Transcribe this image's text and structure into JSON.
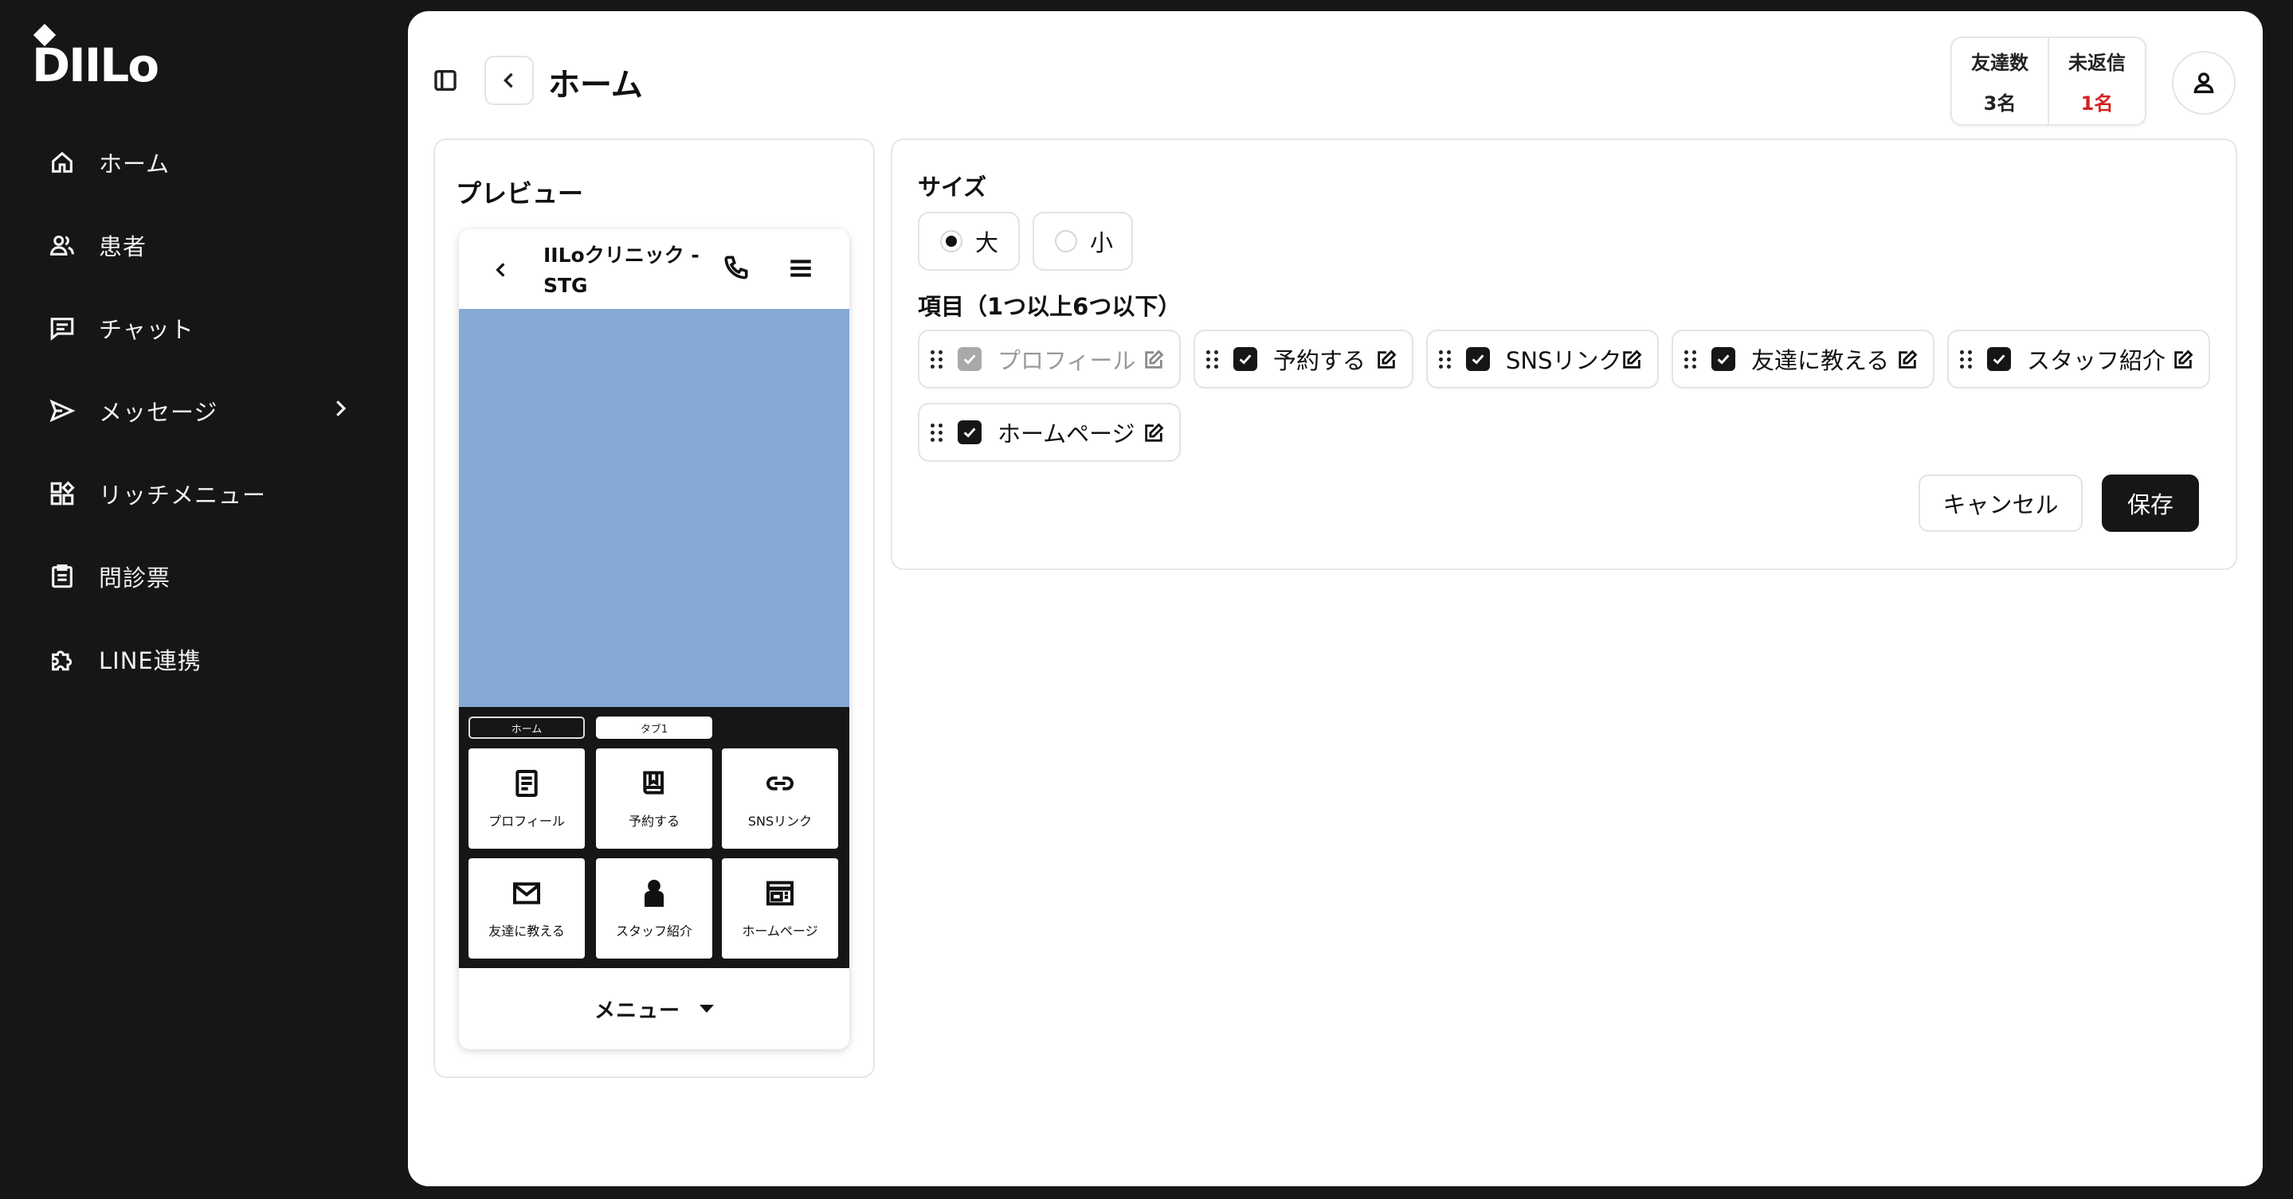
{
  "app": {
    "logo_text": "DIILo",
    "colors": {
      "sidebar_bg": "#161616",
      "hero_bg": "#86a9d6",
      "alert": "#d62020"
    }
  },
  "sidebar": {
    "items": [
      {
        "label": "ホーム",
        "icon": "home-icon"
      },
      {
        "label": "患者",
        "icon": "users-icon"
      },
      {
        "label": "チャット",
        "icon": "chat-icon"
      },
      {
        "label": "メッセージ",
        "icon": "send-icon",
        "has_submenu": true
      },
      {
        "label": "リッチメニュー",
        "icon": "grid-icon"
      },
      {
        "label": "問診票",
        "icon": "clipboard-icon"
      },
      {
        "label": "LINE連携",
        "icon": "puzzle-icon"
      }
    ]
  },
  "header": {
    "title": "ホーム",
    "stats": [
      {
        "label": "友達数",
        "value": "3名"
      },
      {
        "label": "未返信",
        "value": "1名"
      }
    ]
  },
  "preview": {
    "title": "プレビュー",
    "phone_title": "IILoクリニック - STG",
    "tabs": [
      "ホーム",
      "タブ1"
    ],
    "buttons": [
      {
        "label": "プロフィール",
        "icon": "document-icon"
      },
      {
        "label": "予約する",
        "icon": "book-icon"
      },
      {
        "label": "SNSリンク",
        "icon": "link-icon"
      },
      {
        "label": "友達に教える",
        "icon": "mail-icon"
      },
      {
        "label": "スタッフ紹介",
        "icon": "person-icon"
      },
      {
        "label": "ホームページ",
        "icon": "browser-icon"
      }
    ],
    "footer_label": "メニュー"
  },
  "settings": {
    "size_label": "サイズ",
    "size_options": [
      {
        "label": "大",
        "selected": true
      },
      {
        "label": "小",
        "selected": false
      }
    ],
    "items_label": "項目（1つ以上6つ以下）",
    "items": [
      {
        "label": "プロフィール",
        "checked": true,
        "disabled": true
      },
      {
        "label": "予約する",
        "checked": true,
        "disabled": false
      },
      {
        "label": "SNSリンク",
        "checked": true,
        "disabled": false
      },
      {
        "label": "友達に教える",
        "checked": true,
        "disabled": false
      },
      {
        "label": "スタッフ紹介",
        "checked": true,
        "disabled": false
      },
      {
        "label": "ホームページ",
        "checked": true,
        "disabled": false
      }
    ],
    "cancel_label": "キャンセル",
    "save_label": "保存"
  }
}
